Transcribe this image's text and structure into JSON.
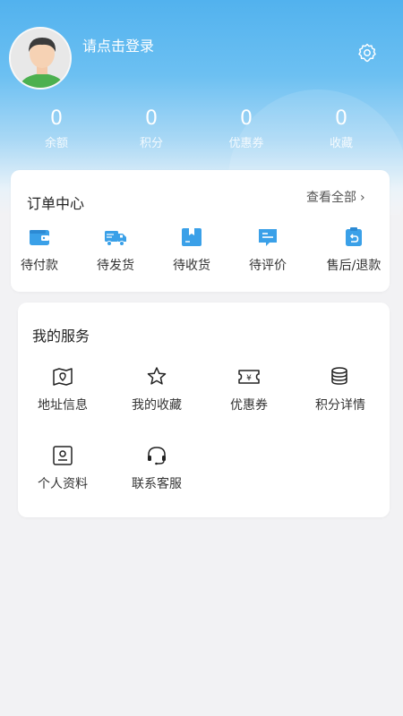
{
  "profile": {
    "login_prompt": "请点击登录",
    "avatar_icon": "user-avatar",
    "settings_icon": "gear-icon"
  },
  "stats": [
    {
      "value": "0",
      "label": "余额"
    },
    {
      "value": "0",
      "label": "积分"
    },
    {
      "value": "0",
      "label": "优惠券"
    },
    {
      "value": "0",
      "label": "收藏"
    }
  ],
  "orders": {
    "title": "订单中心",
    "view_all": "查看全部",
    "items": [
      {
        "label": "待付款",
        "icon": "wallet-icon"
      },
      {
        "label": "待发货",
        "icon": "truck-icon"
      },
      {
        "label": "待收货",
        "icon": "package-icon"
      },
      {
        "label": "待评价",
        "icon": "comment-icon"
      },
      {
        "label": "售后/退款",
        "icon": "refund-icon"
      }
    ]
  },
  "services": {
    "title": "我的服务",
    "items": [
      {
        "label": "地址信息",
        "icon": "map-icon"
      },
      {
        "label": "我的收藏",
        "icon": "star-icon"
      },
      {
        "label": "优惠券",
        "icon": "coupon-icon"
      },
      {
        "label": "积分详情",
        "icon": "coins-icon"
      },
      {
        "label": "个人资料",
        "icon": "profile-card-icon"
      },
      {
        "label": "联系客服",
        "icon": "headset-icon"
      }
    ]
  },
  "colors": {
    "accent": "#3aa0e8",
    "header_top": "#52b2ee",
    "page_bg": "#f2f2f4"
  }
}
